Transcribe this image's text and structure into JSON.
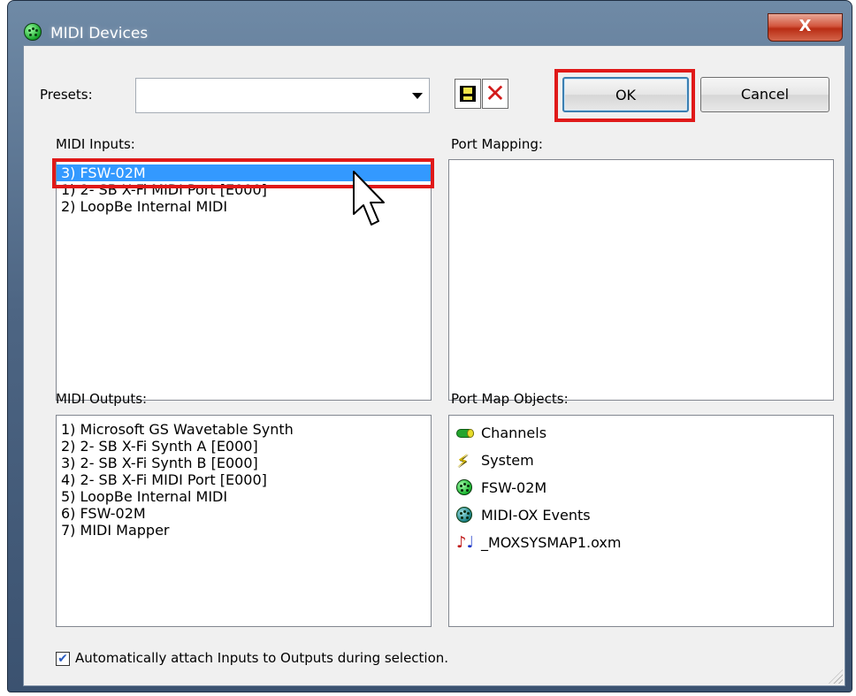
{
  "window": {
    "title": "MIDI Devices",
    "close_glyph": "X"
  },
  "presets": {
    "label": "Presets:",
    "value": ""
  },
  "toolbar": {
    "save_icon": "floppy-disk-icon",
    "delete_icon": "red-x-icon",
    "delete_glyph": "✕"
  },
  "buttons": {
    "ok": "OK",
    "cancel": "Cancel"
  },
  "midi_inputs": {
    "label": "MIDI Inputs:",
    "items": [
      "3)  FSW-02M",
      "1)  2- SB X-Fi MIDI Port [E000]",
      "2)  LoopBe Internal MIDI"
    ],
    "selected_index": 0
  },
  "port_mapping": {
    "label": "Port Mapping:",
    "items": []
  },
  "midi_outputs": {
    "label": "MIDI Outputs:",
    "items": [
      "1)  Microsoft GS Wavetable Synth",
      "2)  2- SB X-Fi Synth A [E000]",
      "3)  2- SB X-Fi Synth B [E000]",
      "4)  2- SB X-Fi MIDI Port [E000]",
      "5)  LoopBe Internal MIDI",
      "6)  FSW-02M",
      "7)  MIDI Mapper"
    ]
  },
  "port_map_objects": {
    "label": "Port Map Objects:",
    "items": [
      {
        "label": "Channels",
        "icon": "channels-icon"
      },
      {
        "label": "System",
        "icon": "lightning-icon"
      },
      {
        "label": "FSW-02M",
        "icon": "midi-port-green-icon"
      },
      {
        "label": "MIDI-OX Events",
        "icon": "midi-port-teal-icon"
      },
      {
        "label": "_MOXSYSMAP1.oxm",
        "icon": "music-notes-icon"
      }
    ]
  },
  "auto_attach": {
    "label": "Automatically attach Inputs to Outputs during selection.",
    "checked": true
  },
  "colors": {
    "selection": "#3399ff",
    "highlight_frame": "#e01919",
    "dialog_bg": "#f0f0f0"
  }
}
